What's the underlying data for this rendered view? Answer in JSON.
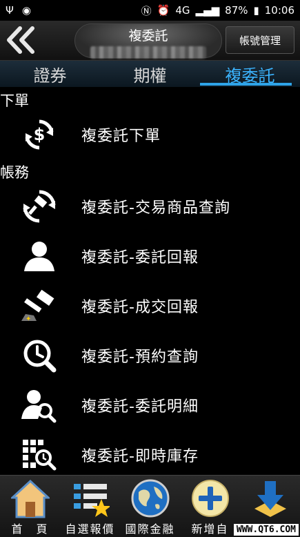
{
  "status_bar": {
    "battery": "87%",
    "time": "10:06",
    "network": "4G"
  },
  "header": {
    "title": "複委託",
    "account_button": "帳號管理"
  },
  "tabs": [
    {
      "label": "證券",
      "active": false
    },
    {
      "label": "期權",
      "active": false
    },
    {
      "label": "複委託",
      "active": true
    }
  ],
  "sections": {
    "order": {
      "title": "下單"
    },
    "account": {
      "title": "帳務"
    }
  },
  "menu": {
    "order_items": [
      {
        "label": "複委託下單",
        "icon": "dollar-cycle-icon"
      }
    ],
    "account_items": [
      {
        "label": "複委託-交易商品查詢",
        "icon": "gavel-cycle-icon"
      },
      {
        "label": "複委託-委託回報",
        "icon": "person-icon"
      },
      {
        "label": "複委託-成交回報",
        "icon": "gavel-icon"
      },
      {
        "label": "複委託-預約查詢",
        "icon": "clock-search-icon"
      },
      {
        "label": "複委託-委託明細",
        "icon": "person-search-icon"
      },
      {
        "label": "複委託-即時庫存",
        "icon": "grid-search-icon"
      }
    ]
  },
  "bottom_nav": [
    {
      "label": "首　頁",
      "icon": "home-icon"
    },
    {
      "label": "自選報價",
      "icon": "watchlist-icon"
    },
    {
      "label": "國際金融",
      "icon": "globe-icon"
    },
    {
      "label": "新增自",
      "icon": "plus-icon"
    },
    {
      "label": "",
      "icon": "download-icon"
    }
  ],
  "watermark": "WWW.QT6.COM",
  "colors": {
    "accent": "#3bb4ff",
    "background": "#000000"
  }
}
